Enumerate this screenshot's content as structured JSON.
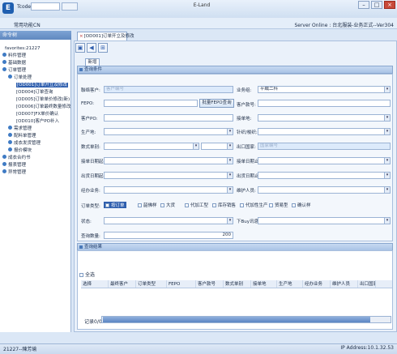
{
  "window": {
    "tcode_label": "Tcode",
    "title_main": "E-Land",
    "menu_item": "常用功能CN",
    "server_status": "Server Online : 台北服装-业务正式--Ver304"
  },
  "sidebar": {
    "header": "命令树",
    "items": [
      {
        "label": "favorites:21227"
      },
      {
        "label": "料件管理"
      },
      {
        "label": "基础数据"
      },
      {
        "label": "订单管理"
      },
      {
        "label": "订单处理"
      },
      {
        "label": "[OD001]订单开立及修改"
      },
      {
        "label": "[OD004]订单查询"
      },
      {
        "label": "[OD005]订单单价修改(新)"
      },
      {
        "label": "[OD006]订单最终数量修改"
      },
      {
        "label": "[OD007]FX单价确认"
      },
      {
        "label": "[OD010]客户PO补入"
      },
      {
        "label": "需求管理"
      },
      {
        "label": "配料单管理"
      },
      {
        "label": "成衣发货管理"
      },
      {
        "label": "报价模块"
      },
      {
        "label": "成衣合约书"
      },
      {
        "label": "报表管理"
      },
      {
        "label": "异常管理"
      }
    ]
  },
  "tab": {
    "label": "[OD001]订单开立及修改"
  },
  "inner_tab": {
    "label": "新增"
  },
  "panels": {
    "query": "查询条件",
    "results": "查询结果"
  },
  "form": {
    "customer_label": "聯络客户:",
    "customer_placeholder": "客户编号",
    "fepo_label": "FEPO:",
    "customer_po_label": "客户PO:",
    "production_label": "生产地:",
    "currency_label": "数式单别:",
    "order_date_label": "接单日期起:",
    "ship_date_label": "出货日期起:",
    "agent_label": "经办业务:",
    "order_type_label": "订单类型:",
    "status_label": "状态:",
    "qty_label": "查询数量:",
    "qty_value": "200",
    "btn_fepo": "批量FEPO查询",
    "business_label": "业务组:",
    "business_value": "平織二科",
    "customer_no_label": "客户款号:",
    "order_to_label": "接单地:",
    "knit_label": "针织/梭织:",
    "export_label": "出口国家:",
    "export_placeholder": "国家编号",
    "order_date_end_label": "接单日期止:",
    "ship_date_end_label": "出货日期止:",
    "maintainer_label": "维护人员:",
    "mobile_label": "下Buy讯息:",
    "order_types": [
      "按订单",
      "韶佛样",
      "大货",
      "代加工型",
      "库存销售",
      "代加性生产",
      "贸易型",
      "确认样"
    ]
  },
  "results": {
    "select_all": "全选",
    "columns": [
      "选择",
      "最终客户",
      "订单类型",
      "FEPO",
      "客户款号",
      "数式单别",
      "接单地",
      "生产地",
      "经办业务",
      "维护人员",
      "出口国家"
    ],
    "record_label": "记录0/0"
  },
  "status": {
    "user": "21227--陳芳瑜",
    "ip": "IP Address:10.1.32.53"
  }
}
